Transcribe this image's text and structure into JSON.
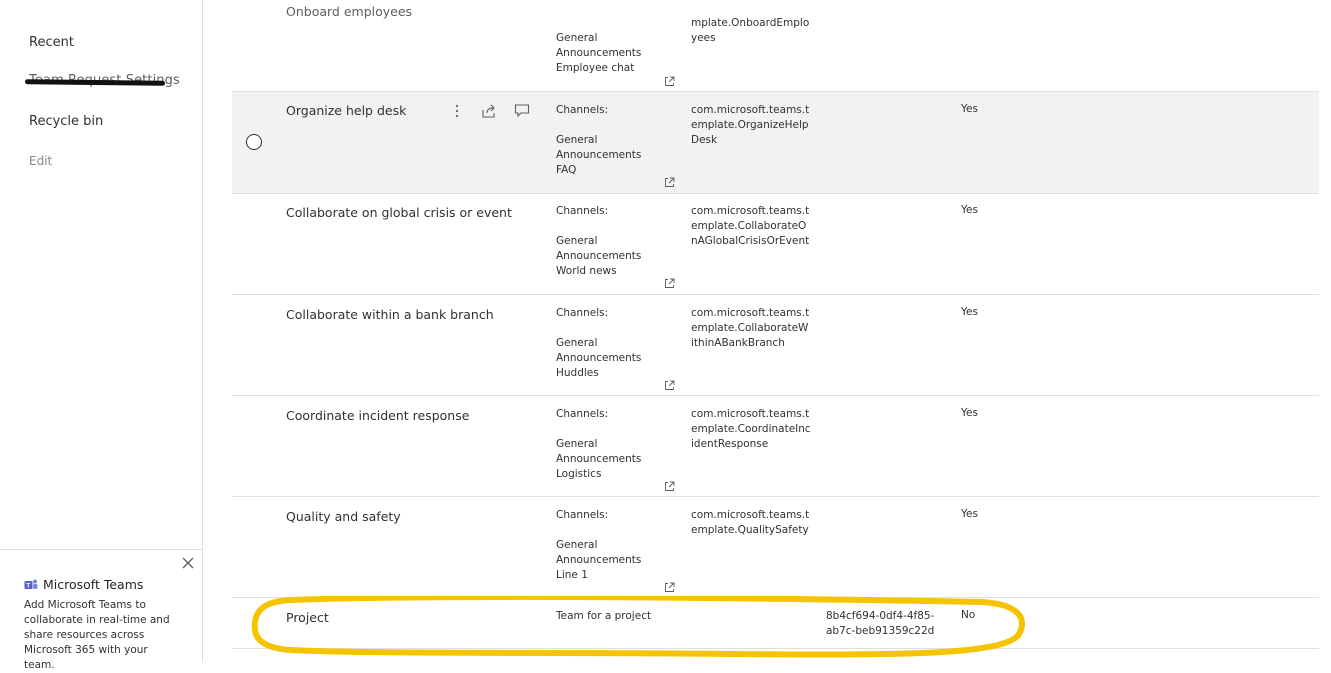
{
  "sidebar": {
    "items": [
      {
        "label": "Recent"
      },
      {
        "label": "Team Request Settings"
      },
      {
        "label": "Recycle bin"
      },
      {
        "label": "Edit"
      }
    ],
    "promo": {
      "title": "Microsoft Teams",
      "text": "Add Microsoft Teams to collaborate in real-time and share resources across Microsoft 365 with your team."
    }
  },
  "table": {
    "rows": [
      {
        "name": "Onboard employees",
        "channels": "General\nAnnouncements\nEmployee chat",
        "identifier": "mplate.OnboardEmployees",
        "default": ""
      },
      {
        "name": "Organize help desk",
        "channels": "Channels:\n\nGeneral\nAnnouncements\nFAQ",
        "identifier": "com.microsoft.teams.template.OrganizeHelpDesk",
        "default": "Yes"
      },
      {
        "name": "Collaborate on global crisis or event",
        "channels": "Channels:\n\nGeneral\nAnnouncements\nWorld news",
        "identifier": "com.microsoft.teams.template.CollaborateOnAGlobalCrisisOrEvent",
        "default": "Yes"
      },
      {
        "name": "Collaborate within a bank branch",
        "channels": "Channels:\n\nGeneral\nAnnouncements\nHuddles",
        "identifier": "com.microsoft.teams.template.CollaborateWithinABankBranch",
        "default": "Yes"
      },
      {
        "name": "Coordinate incident response",
        "channels": "Channels:\n\nGeneral\nAnnouncements\nLogistics",
        "identifier": "com.microsoft.teams.template.CoordinateIncidentResponse",
        "default": "Yes"
      },
      {
        "name": "Quality and safety",
        "channels": "Channels:\n\nGeneral\nAnnouncements\nLine 1",
        "identifier": "com.microsoft.teams.template.QualitySafety",
        "default": "Yes"
      },
      {
        "name": "Project",
        "description": "Team for a project",
        "guid": "8b4cf694-0df4-4f85-ab7c-beb91359c22d",
        "default": "No"
      }
    ]
  },
  "colors": {
    "selected_row": "#f3f2f1",
    "highlight": "#f5c400",
    "divider": "#e1dfdd"
  },
  "icons": [
    "more-options-icon",
    "share-icon",
    "comment-icon",
    "external-link-icon",
    "close-icon",
    "teams-logo-icon",
    "radio-icon"
  ]
}
